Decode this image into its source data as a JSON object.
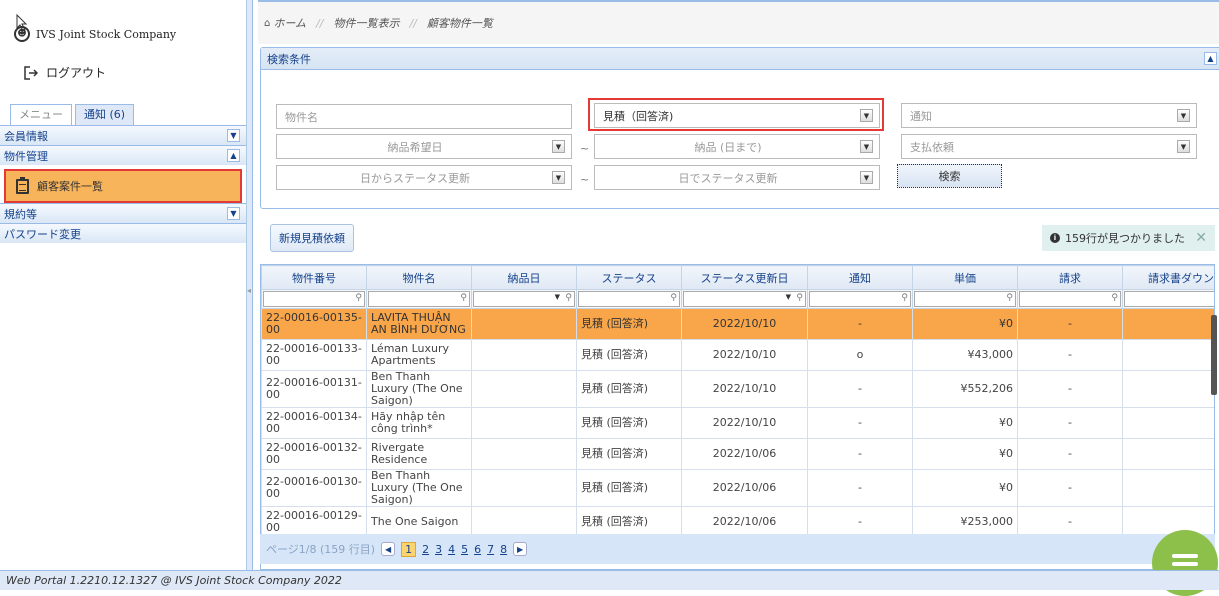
{
  "sidebar": {
    "company": "IVS Joint Stock Company",
    "logout": "ログアウト",
    "tabs": [
      {
        "label": "メニュー"
      },
      {
        "label": "通知 (6)"
      }
    ],
    "nav": {
      "members": "会員情報",
      "properties": "物件管理",
      "property_list": "顧客案件一覧",
      "terms": "規約等",
      "password": "パスワード変更"
    }
  },
  "breadcrumb": {
    "home": "ホーム",
    "sep": "//",
    "view": "物件一覧表示",
    "current": "顧客物件一覧"
  },
  "search": {
    "title": "検索条件",
    "property_name_placeholder": "物件名",
    "status_value": "見積（回答済)",
    "notice_placeholder": "通知",
    "delivery_desired_placeholder": "納品希望日",
    "delivery_until_placeholder": "納品 (日まで)",
    "payment_placeholder": "支払依頼",
    "status_from_placeholder": "日からステータス更新",
    "status_to_placeholder": "日でステータス更新",
    "tilde": "~",
    "search_button": "検索"
  },
  "actions": {
    "new_quote": "新規見積依頼",
    "found": "159行が見つかりました",
    "close": "✕"
  },
  "grid": {
    "columns": [
      "物件番号",
      "物件名",
      "納品日",
      "ステータス",
      "ステータス更新日",
      "通知",
      "単価",
      "請求",
      "請求書ダウンロー"
    ],
    "rows": [
      {
        "id": "22-00016-00135-00",
        "name": "LAVITA THUẬN AN BÌNH DƯƠNG",
        "delivery": "",
        "status": "見積 (回答済)",
        "updated": "2022/10/10",
        "notice": "-",
        "price": "¥0",
        "invoice": "-",
        "download": ""
      },
      {
        "id": "22-00016-00133-00",
        "name": "Léman Luxury Apartments",
        "delivery": "",
        "status": "見積 (回答済)",
        "updated": "2022/10/10",
        "notice": "o",
        "price": "¥43,000",
        "invoice": "-",
        "download": ""
      },
      {
        "id": "22-00016-00131-00",
        "name": "Ben Thanh Luxury (The One Saigon)",
        "delivery": "",
        "status": "見積 (回答済)",
        "updated": "2022/10/10",
        "notice": "-",
        "price": "¥552,206",
        "invoice": "-",
        "download": ""
      },
      {
        "id": "22-00016-00134-00",
        "name": "Hãy nhập tên công trình*",
        "delivery": "",
        "status": "見積 (回答済)",
        "updated": "2022/10/10",
        "notice": "-",
        "price": "¥0",
        "invoice": "-",
        "download": ""
      },
      {
        "id": "22-00016-00132-00",
        "name": "Rivergate Residence",
        "delivery": "",
        "status": "見積 (回答済)",
        "updated": "2022/10/06",
        "notice": "-",
        "price": "¥0",
        "invoice": "-",
        "download": ""
      },
      {
        "id": "22-00016-00130-00",
        "name": "Ben Thanh Luxury (The One Saigon)",
        "delivery": "",
        "status": "見積 (回答済)",
        "updated": "2022/10/06",
        "notice": "-",
        "price": "¥0",
        "invoice": "-",
        "download": ""
      },
      {
        "id": "22-00016-00129-00",
        "name": "The One Saigon",
        "delivery": "",
        "status": "見積 (回答済)",
        "updated": "2022/10/06",
        "notice": "-",
        "price": "¥253,000",
        "invoice": "-",
        "download": ""
      }
    ]
  },
  "pager": {
    "info": "ページ1/8 (159 行目)",
    "pages": [
      "1",
      "2",
      "3",
      "4",
      "5",
      "6",
      "7",
      "8"
    ]
  },
  "footer": "Web Portal 1.2210.12.1327 @ IVS Joint Stock Company 2022",
  "colors": {
    "accent": "#15428b",
    "selected_row": "#f9a64a",
    "highlight": "#e53935",
    "chat": "#8cc04b"
  }
}
